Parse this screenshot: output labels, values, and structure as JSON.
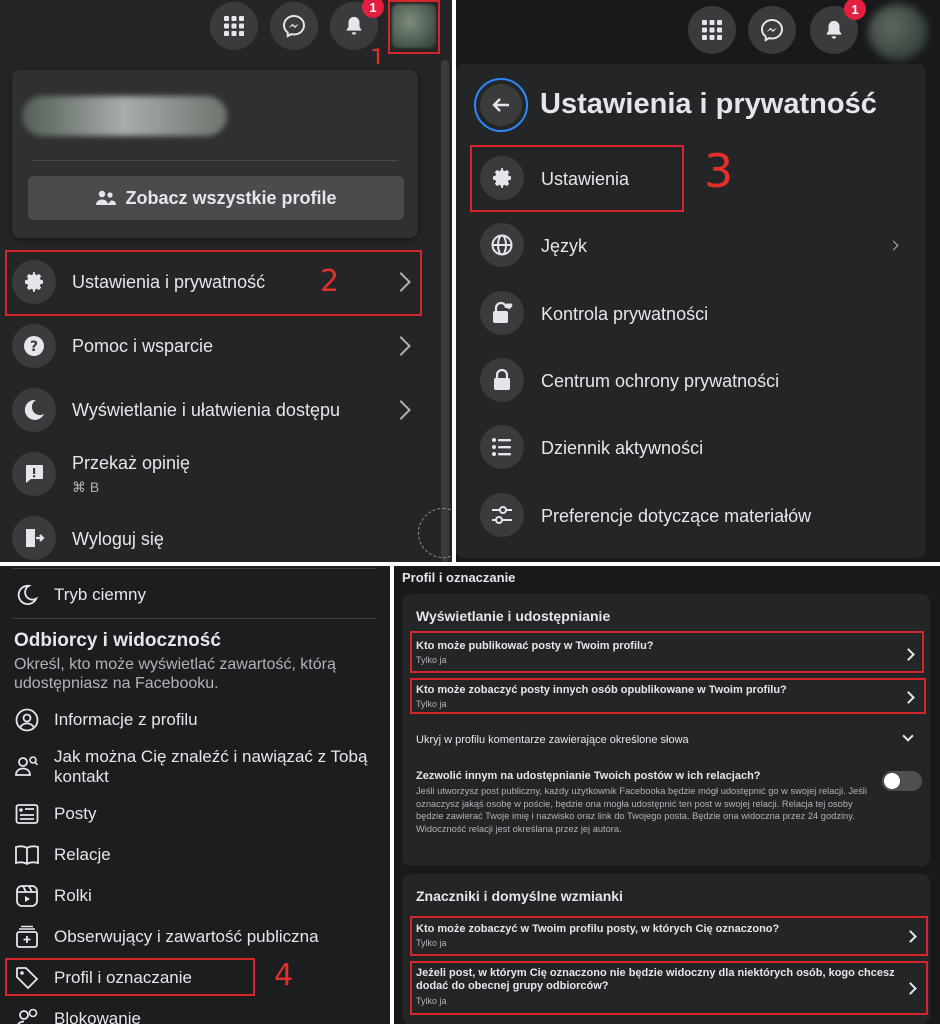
{
  "topbar": {
    "notification_count": "1",
    "icons": [
      "menu-grid-icon",
      "messenger-icon",
      "bell-icon",
      "avatar"
    ]
  },
  "account_menu": {
    "see_all_profiles": "Zobacz wszystkie profile",
    "items": [
      {
        "label": "Ustawienia i prywatność",
        "icon": "gear-icon"
      },
      {
        "label": "Pomoc i wsparcie",
        "icon": "help-icon"
      },
      {
        "label": "Wyświetlanie i ułatwienia dostępu",
        "icon": "moon-icon"
      },
      {
        "label": "Przekaż opinię",
        "shortcut": "⌘ B",
        "icon": "feedback-icon"
      },
      {
        "label": "Wyloguj się",
        "icon": "logout-icon"
      }
    ]
  },
  "settings_privacy": {
    "title": "Ustawienia i prywatność",
    "items": [
      {
        "label": "Ustawienia",
        "icon": "gear-icon"
      },
      {
        "label": "Język",
        "icon": "globe-icon"
      },
      {
        "label": "Kontrola prywatności",
        "icon": "lock-heart-icon"
      },
      {
        "label": "Centrum ochrony prywatności",
        "icon": "lock-icon"
      },
      {
        "label": "Dziennik aktywności",
        "icon": "list-icon"
      },
      {
        "label": "Preferencje dotyczące materiałów",
        "icon": "sliders-icon"
      }
    ]
  },
  "settings_sidebar": {
    "dark_mode": "Tryb ciemny",
    "section_title": "Odbiorcy i widoczność",
    "section_desc": "Określ, kto może wyświetlać zawartość, którą udostępniasz na Facebooku.",
    "items": [
      {
        "label": "Informacje z profilu",
        "icon": "user-circle-icon"
      },
      {
        "label": "Jak można Cię znaleźć i nawiązać z Tobą kontakt",
        "icon": "user-search-icon"
      },
      {
        "label": "Posty",
        "icon": "post-icon"
      },
      {
        "label": "Relacje",
        "icon": "book-icon"
      },
      {
        "label": "Rolki",
        "icon": "reels-icon"
      },
      {
        "label": "Obserwujący i zawartość publiczna",
        "icon": "followers-icon"
      },
      {
        "label": "Profil i oznaczanie",
        "icon": "tag-icon"
      },
      {
        "label": "Blokowanie",
        "icon": "block-icon"
      }
    ]
  },
  "profile_tagging": {
    "title": "Profil i oznaczanie",
    "section1": {
      "heading": "Wyświetlanie i udostępnianie",
      "q1": {
        "title": "Kto może publikować posty w Twoim profilu?",
        "value": "Tylko ja"
      },
      "q2": {
        "title": "Kto może zobaczyć posty innych osób opublikowane w Twoim profilu?",
        "value": "Tylko ja"
      },
      "hide_comments": "Ukryj w profilu komentarze zawierające określone słowa",
      "share_stories_title": "Zezwolić innym na udostępnianie Twoich postów w ich relacjach?",
      "share_stories_desc": "Jeśli utworzysz post publiczny, każdy użytkownik Facebooka będzie mógł udostępnić go w swojej relacji. Jeśli oznaczysz jakąś osobę w poście, będzie ona mogła udostępnić ten post w swojej relacji. Relacja tej osoby będzie zawierać Twoje imię i nazwisko oraz link do Twojego posta. Będzie ona widoczna przez 24 godziny. Widoczność relacji jest określana przez jej autora."
    },
    "section2": {
      "heading": "Znaczniki i domyślne wzmianki",
      "q1": {
        "title": "Kto może zobaczyć w Twoim profilu posty, w których Cię oznaczono?",
        "value": "Tylko ja"
      },
      "q2": {
        "title": "Jeżeli post, w którym Cię oznaczono nie będzie widoczny dla niektórych osób, kogo chcesz dodać do obecnej grupy odbiorców?",
        "value": "Tylko ja"
      }
    }
  },
  "annotations": {
    "n1": "1",
    "n2": "2",
    "n3": "3",
    "n4": "4"
  },
  "colors": {
    "annotation_red": "#d7262b",
    "panel_bg": "#242526",
    "badge_red": "#e41e3f"
  }
}
